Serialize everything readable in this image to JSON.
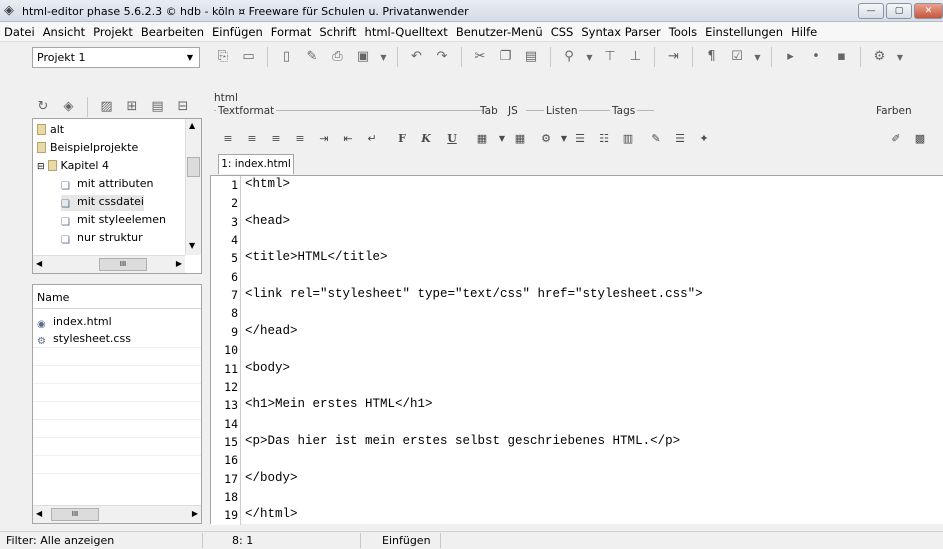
{
  "window": {
    "title": "html-editor phase 5.6.2.3 © hdb - köln ¤ Freeware für Schulen u. Privatanwender",
    "buttons": [
      "—",
      "▢",
      "✕"
    ]
  },
  "menu": [
    "Datei",
    "Ansicht",
    "Projekt",
    "Bearbeiten",
    "Einfügen",
    "Format",
    "Schrift",
    "html-Quelltext",
    "Benutzer-Menü",
    "CSS",
    "Syntax Parser",
    "Tools",
    "Einstellungen",
    "Hilfe"
  ],
  "project": {
    "selected": "Projekt 1"
  },
  "tree": {
    "items": [
      {
        "label": "alt",
        "kind": "folder"
      },
      {
        "label": "Beispielprojekte",
        "kind": "folder"
      },
      {
        "label": "Kapitel 4",
        "kind": "folder-open"
      },
      {
        "label": "mit attributen",
        "kind": "item"
      },
      {
        "label": "mit cssdatei",
        "kind": "item"
      },
      {
        "label": "mit styleelemen",
        "kind": "item"
      },
      {
        "label": "nur struktur",
        "kind": "item"
      }
    ],
    "scroll_thumb": "III"
  },
  "files": {
    "header": "Name",
    "items": [
      "index.html",
      "stylesheet.css"
    ],
    "scroll_thumb": "III"
  },
  "editor": {
    "section_label": "html",
    "groups": {
      "textformat": "Textformat",
      "tab": "Tab",
      "js": "JS",
      "listen": "Listen",
      "tags": "Tags",
      "farben": "Farben"
    },
    "format_buttons": {
      "bold": "F",
      "italic": "K",
      "underline": "U"
    },
    "tab_label": "1: index.html",
    "lines": [
      "<html>",
      "",
      "<head>",
      "",
      "<title>HTML</title>",
      "",
      "<link rel=\"stylesheet\" type=\"text/css\" href=\"stylesheet.css\">",
      "",
      "</head>",
      "",
      "<body>",
      "",
      "<h1>Mein erstes HTML</h1>",
      "",
      "<p>Das hier ist mein erstes selbst geschriebenes HTML.</p>",
      "",
      "</body>",
      "",
      "</html>"
    ],
    "line_numbers": [
      "1",
      "2",
      "3",
      "4",
      "5",
      "6",
      "7",
      "8",
      "9",
      "10",
      "11",
      "12",
      "13",
      "14",
      "15",
      "16",
      "17",
      "18",
      "19"
    ]
  },
  "status": {
    "filter": "Filter: Alle anzeigen",
    "position": "8: 1",
    "mode": "Einfügen"
  }
}
